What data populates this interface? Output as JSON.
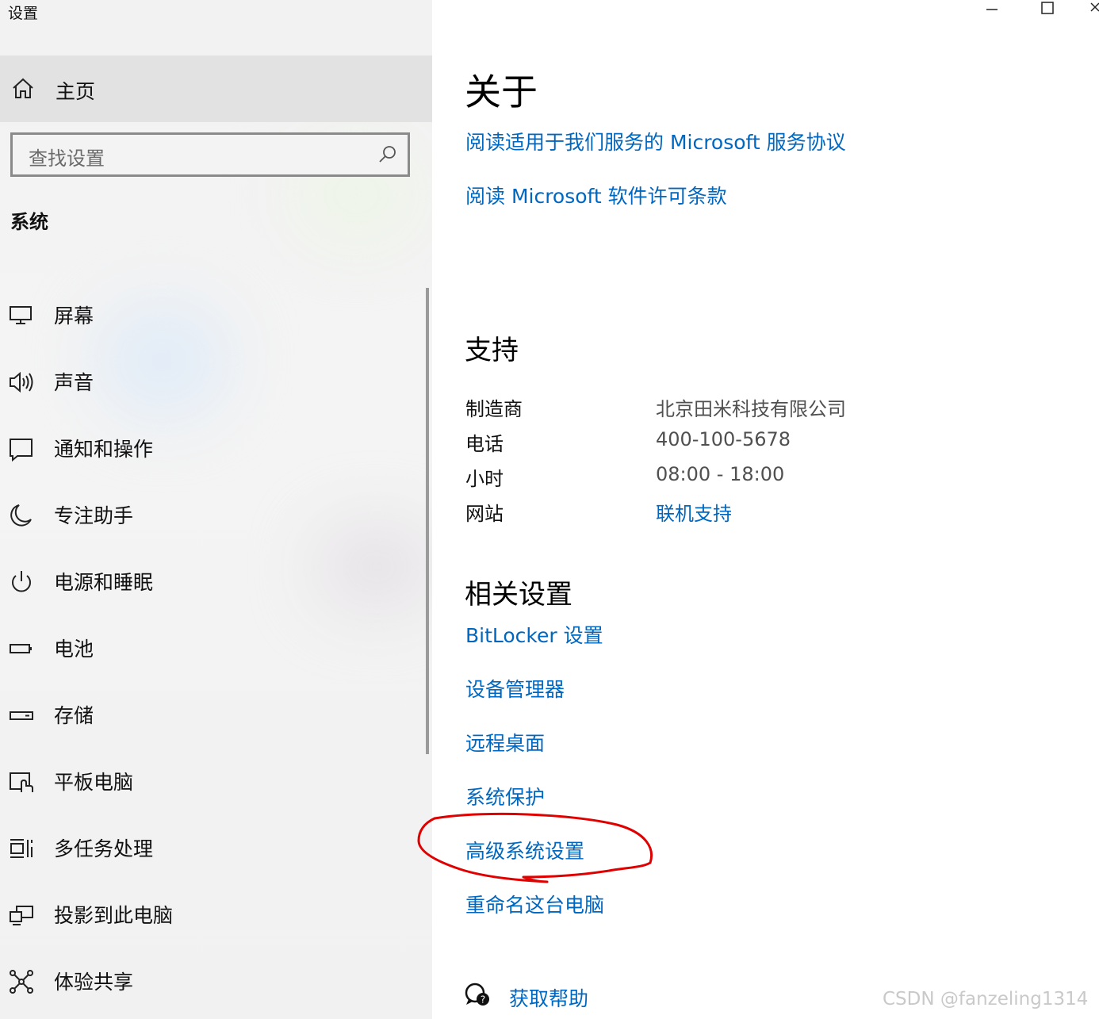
{
  "window": {
    "title": "设置",
    "minimize_glyph": "—",
    "maximize_glyph": "☐",
    "close_glyph": "✕"
  },
  "sidebar": {
    "home": {
      "label": "主页",
      "icon": "home-icon"
    },
    "search": {
      "placeholder": "查找设置",
      "icon": "search-icon"
    },
    "section_title": "系统",
    "items": [
      {
        "label": "屏幕",
        "icon": "monitor-icon"
      },
      {
        "label": "声音",
        "icon": "speaker-icon"
      },
      {
        "label": "通知和操作",
        "icon": "notification-icon"
      },
      {
        "label": "专注助手",
        "icon": "moon-icon"
      },
      {
        "label": "电源和睡眠",
        "icon": "power-icon"
      },
      {
        "label": "电池",
        "icon": "battery-icon"
      },
      {
        "label": "存储",
        "icon": "storage-icon"
      },
      {
        "label": "平板电脑",
        "icon": "tablet-icon"
      },
      {
        "label": "多任务处理",
        "icon": "multitask-icon"
      },
      {
        "label": "投影到此电脑",
        "icon": "project-icon"
      },
      {
        "label": "体验共享",
        "icon": "share-icon"
      }
    ]
  },
  "main": {
    "about_title": "关于",
    "about_links": [
      "阅读适用于我们服务的 Microsoft 服务协议",
      "阅读 Microsoft 软件许可条款"
    ],
    "support": {
      "title": "支持",
      "rows": [
        {
          "key": "制造商",
          "value": "北京田米科技有限公司"
        },
        {
          "key": "电话",
          "value": "400-100-5678"
        },
        {
          "key": "小时",
          "value": "08:00 - 18:00"
        },
        {
          "key": "网站",
          "value": "联机支持"
        }
      ]
    },
    "related": {
      "title": "相关设置",
      "links": [
        "BitLocker 设置",
        "设备管理器",
        "远程桌面",
        "系统保护",
        "高级系统设置",
        "重命名这台电脑"
      ]
    },
    "help": {
      "label": "获取帮助",
      "icon": "help-chat-icon"
    }
  },
  "watermark": "CSDN @fanzeling1314",
  "colors": {
    "link": "#0067c0",
    "annotation": "#e00000",
    "sidebar_bg": "#f2f2f2",
    "home_bg": "#e2e2e2"
  }
}
